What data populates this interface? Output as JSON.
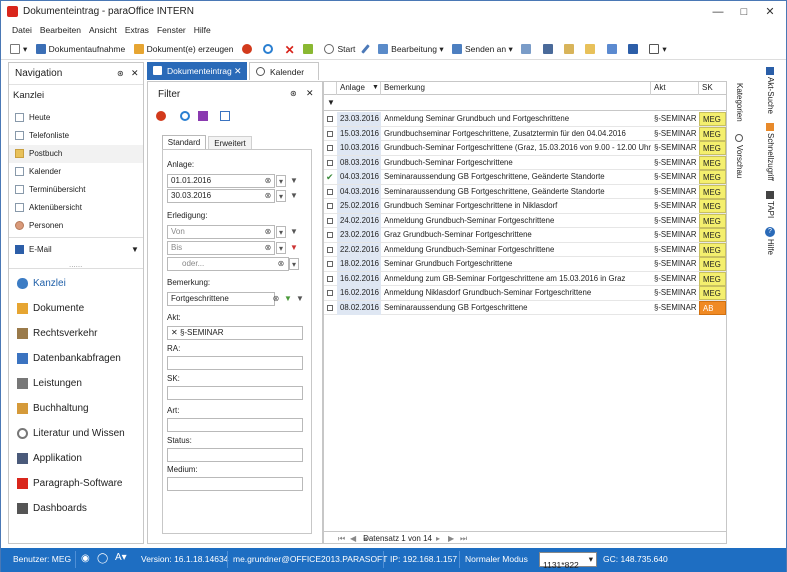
{
  "window": {
    "title": "Dokumenteintrag - paraOffice INTERN"
  },
  "menu": [
    "Datei",
    "Bearbeiten",
    "Ansicht",
    "Extras",
    "Fenster",
    "Hilfe"
  ],
  "toolbar": {
    "dokumentaufnahme": "Dokumentaufnahme",
    "dokument_erzeugen": "Dokument(e) erzeugen",
    "start": "Start",
    "bearbeitung": "Bearbeitung",
    "senden_an": "Senden an"
  },
  "navigation": {
    "title": "Navigation",
    "section": "Kanzlei",
    "items": [
      "Heute",
      "Telefonliste",
      "Postbuch",
      "Kalender",
      "Terminübersicht",
      "Aktenübersicht",
      "Personen"
    ],
    "email": "E-Mail",
    "modules": [
      "Kanzlei",
      "Dokumente",
      "Rechtsverkehr",
      "Datenbankabfragen",
      "Leistungen",
      "Buchhaltung",
      "Literatur und Wissen",
      "Applikation",
      "Paragraph-Software",
      "Dashboards"
    ]
  },
  "tabs": [
    "Dokumenteintrag",
    "Kalender"
  ],
  "filter": {
    "title": "Filter",
    "tabs": [
      "Standard",
      "Erweitert"
    ],
    "anlage_label": "Anlage:",
    "anlage_from": "01.01.2016",
    "anlage_to": "30.03.2016",
    "erledigung_label": "Erledigung:",
    "von_placeholder": "Von",
    "bis_placeholder": "Bis",
    "oder_placeholder": "oder...",
    "bemerkung_label": "Bemerkung:",
    "bemerkung_value": "Fortgeschrittene",
    "akt_label": "Akt:",
    "akt_value": "§-SEMINAR",
    "ra_label": "RA:",
    "sk_label": "SK:",
    "art_label": "Art:",
    "status_label": "Status:",
    "medium_label": "Medium:"
  },
  "grid": {
    "columns": [
      "Anlage",
      "Bemerkung",
      "Akt",
      "SK"
    ],
    "rows": [
      {
        "date": "23.03.2016",
        "text": "Anmeldung Seminar Grundbuch und Fortgeschrittene",
        "akt": "§-SEMINAR",
        "sk": "MEG"
      },
      {
        "date": "15.03.2016",
        "text": "Grundbuchseminar Fortgeschrittene,  Zusatztermin für den 04.04.2016",
        "akt": "§-SEMINAR",
        "sk": "MEG"
      },
      {
        "date": "10.03.2016",
        "text": "Grundbuch-Seminar Fortgeschrittene (Graz, 15.03.2016 von 9.00 - 12.00 Uhr)",
        "akt": "§-SEMINAR",
        "sk": "MEG"
      },
      {
        "date": "08.03.2016",
        "text": "Grundbuch-Seminar Fortgeschrittene",
        "akt": "§-SEMINAR",
        "sk": "MEG"
      },
      {
        "date": "04.03.2016",
        "text": "Seminaraussendung GB Fortgeschrittene, Geänderte Standorte",
        "akt": "§-SEMINAR",
        "sk": "MEG"
      },
      {
        "date": "04.03.2016",
        "text": "Seminaraussendung GB Fortgeschrittene, Geänderte Standorte",
        "akt": "§-SEMINAR",
        "sk": "MEG"
      },
      {
        "date": "25.02.2016",
        "text": "Grundbuch Seminar Fortgeschrittene in Niklasdorf",
        "akt": "§-SEMINAR",
        "sk": "MEG"
      },
      {
        "date": "24.02.2016",
        "text": "Anmeldung Grundbuch-Seminar Fortgeschrittene",
        "akt": "§-SEMINAR",
        "sk": "MEG"
      },
      {
        "date": "23.02.2016",
        "text": "Graz Grundbuch-Seminar Fortgeschrittene",
        "akt": "§-SEMINAR",
        "sk": "MEG"
      },
      {
        "date": "22.02.2016",
        "text": "Anmeldung Grundbuch-Seminar Fortgeschrittene",
        "akt": "§-SEMINAR",
        "sk": "MEG"
      },
      {
        "date": "18.02.2016",
        "text": "Seminar Grundbuch Fortgeschrittene",
        "akt": "§-SEMINAR",
        "sk": "MEG"
      },
      {
        "date": "16.02.2016",
        "text": "Anmeldung zum GB-Seminar Fortgeschrittene am 15.03.2016 in Graz",
        "akt": "§-SEMINAR",
        "sk": "MEG"
      },
      {
        "date": "16.02.2016",
        "text": "Anmeldung Niklasdorf Grundbuch-Seminar Fortgeschrittene",
        "akt": "§-SEMINAR",
        "sk": "MEG"
      },
      {
        "date": "08.02.2016",
        "text": "Seminaraussendung GB Fortgeschrittene",
        "akt": "§-SEMINAR",
        "sk": "AB"
      }
    ],
    "footer": "Datensatz 1 von 14"
  },
  "side_panels": {
    "inner": [
      "Kategorien",
      "Vorschau"
    ],
    "outer": [
      "Akt-Suche",
      "Schnellzugriff",
      "TAPI",
      "Hilfe"
    ]
  },
  "status": {
    "user": "Benutzer: MEG",
    "version": "Version: 16.1.18.14634",
    "email": "me.grundner@OFFICE2013.PARASOFT",
    "ip": "IP: 192.168.1.157",
    "mode": "Normaler Modus",
    "resolution": "1131*822",
    "gc": "GC: 148.735.640"
  }
}
